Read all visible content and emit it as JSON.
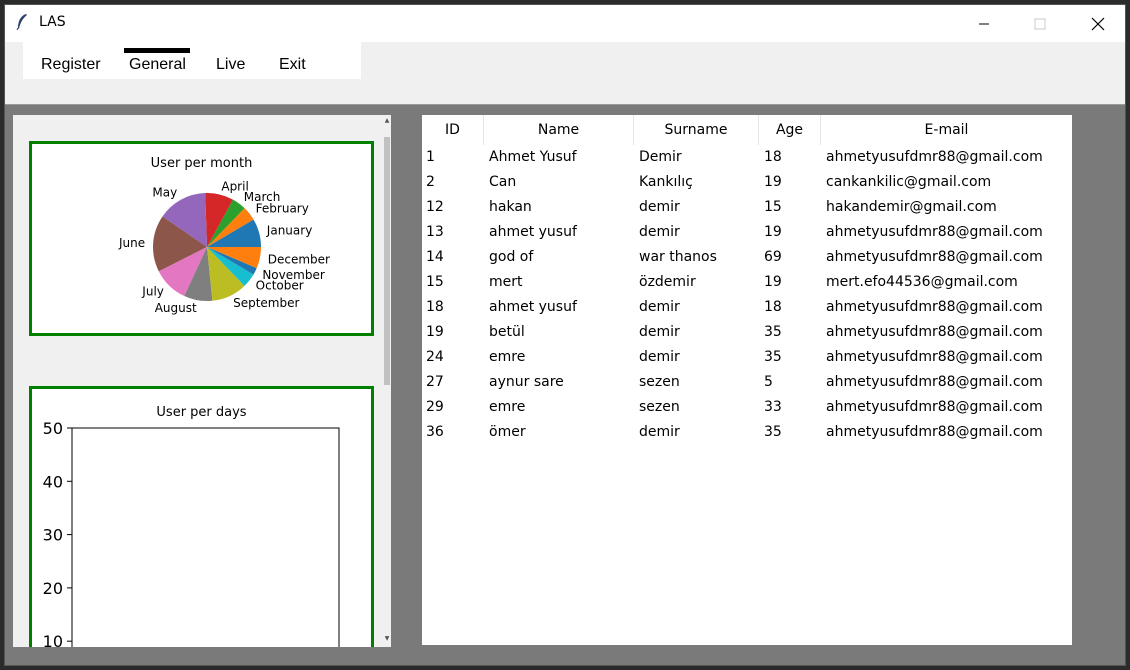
{
  "window": {
    "title": "LAS"
  },
  "menu": {
    "items": [
      "Register",
      "General",
      "Live",
      "Exit"
    ],
    "active": "General"
  },
  "charts": {
    "pie_title": "User per month",
    "days_title": "User per days"
  },
  "chart_data": [
    {
      "type": "pie",
      "title": "User per month",
      "categories": [
        "January",
        "February",
        "March",
        "April",
        "May",
        "June",
        "July",
        "August",
        "September",
        "October",
        "November",
        "December"
      ],
      "values": [
        2,
        1,
        1,
        2,
        3.5,
        4,
        2.5,
        2,
        2.5,
        1,
        0.5,
        1.5
      ],
      "colors": [
        "#1f77b4",
        "#ff7f0e",
        "#2ca02c",
        "#d62728",
        "#9467bd",
        "#8c564b",
        "#e377c2",
        "#7f7f7f",
        "#bcbd22",
        "#17becf",
        "#1f77b4",
        "#ff7f0e"
      ]
    },
    {
      "type": "bar",
      "title": "User per days",
      "categories": [],
      "values": [],
      "yticks": [
        10,
        20,
        30,
        40,
        50
      ],
      "ylim": [
        0,
        50
      ]
    }
  ],
  "table": {
    "columns": [
      "ID",
      "Name",
      "Surname",
      "Age",
      "E-mail"
    ],
    "rows": [
      [
        "1",
        "Ahmet Yusuf",
        "Demir",
        "18",
        "ahmetyusufdmr88@gmail.com"
      ],
      [
        "2",
        "Can",
        "Kankılıç",
        "19",
        "cankankilic@gmail.com"
      ],
      [
        "12",
        "hakan",
        "demir",
        "15",
        "hakandemir@gmail.com"
      ],
      [
        "13",
        "ahmet yusuf",
        "demir",
        "19",
        "ahmetyusufdmr88@gmail.com"
      ],
      [
        "14",
        "god of",
        "war thanos",
        "69",
        "ahmetyusufdmr88@gmail.com"
      ],
      [
        "15",
        "mert",
        "özdemir",
        "19",
        "mert.efo44536@gmail.com"
      ],
      [
        "18",
        "ahmet yusuf",
        "demir",
        "18",
        "ahmetyusufdmr88@gmail.com"
      ],
      [
        "19",
        "betül",
        "demir",
        "35",
        "ahmetyusufdmr88@gmail.com"
      ],
      [
        "24",
        "emre",
        "demir",
        "35",
        "ahmetyusufdmr88@gmail.com"
      ],
      [
        "27",
        "aynur sare",
        "sezen",
        "5",
        "ahmetyusufdmr88@gmail.com"
      ],
      [
        "29",
        "emre",
        "sezen",
        "33",
        "ahmetyusufdmr88@gmail.com"
      ],
      [
        "36",
        "ömer",
        "demir",
        "35",
        "ahmetyusufdmr88@gmail.com"
      ]
    ]
  }
}
